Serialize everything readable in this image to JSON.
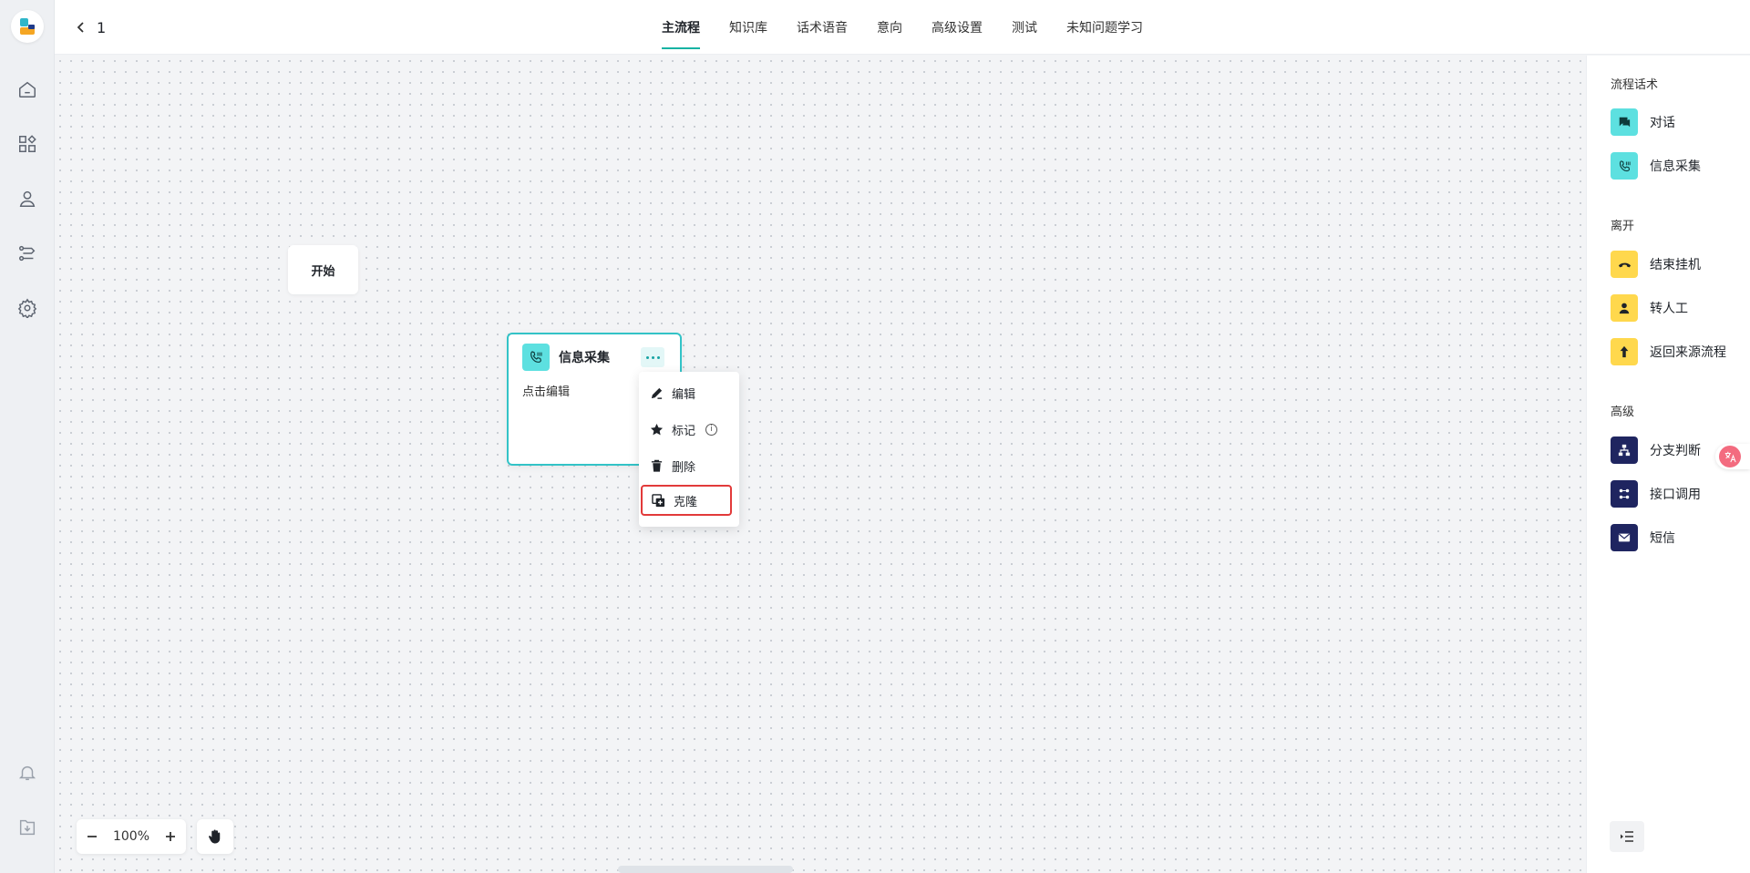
{
  "app": {
    "flow_title": "1"
  },
  "tabs": [
    {
      "label": "主流程",
      "active": true
    },
    {
      "label": "知识库"
    },
    {
      "label": "话术语音"
    },
    {
      "label": "意向"
    },
    {
      "label": "高级设置"
    },
    {
      "label": "测试"
    },
    {
      "label": "未知问题学习"
    }
  ],
  "left_nav": [
    "home-icon",
    "apps-icon",
    "user-group-icon",
    "flow-icon",
    "settings-icon",
    "bell-icon",
    "download-icon"
  ],
  "canvas": {
    "start_node": {
      "label": "开始"
    },
    "info_node": {
      "title": "信息采集",
      "desc": "点击编辑"
    },
    "context_menu": {
      "items": [
        {
          "label": "编辑",
          "icon": "edit-icon"
        },
        {
          "label": "标记",
          "icon": "star-icon"
        },
        {
          "label": "删除",
          "icon": "trash-icon"
        },
        {
          "label": "克隆",
          "icon": "clone-icon",
          "highlighted": true
        }
      ]
    },
    "zoom": {
      "value": "100%"
    }
  },
  "panel": {
    "sections": [
      {
        "title": "流程话术",
        "items": [
          {
            "label": "对话",
            "color": "#5de0e0"
          },
          {
            "label": "信息采集",
            "color": "#5de0e0"
          }
        ]
      },
      {
        "title": "离开",
        "items": [
          {
            "label": "结束挂机",
            "color": "#ffd84d"
          },
          {
            "label": "转人工",
            "color": "#ffd84d"
          },
          {
            "label": "返回来源流程",
            "color": "#ffd84d"
          }
        ]
      },
      {
        "title": "高级",
        "items": [
          {
            "label": "分支判断",
            "color": "#1f2560"
          },
          {
            "label": "接口调用",
            "color": "#1f2560"
          },
          {
            "label": "短信",
            "color": "#1f2560"
          }
        ]
      }
    ]
  },
  "colors": {
    "accent": "#17b3a3",
    "highlight_border": "#e23a3a"
  }
}
